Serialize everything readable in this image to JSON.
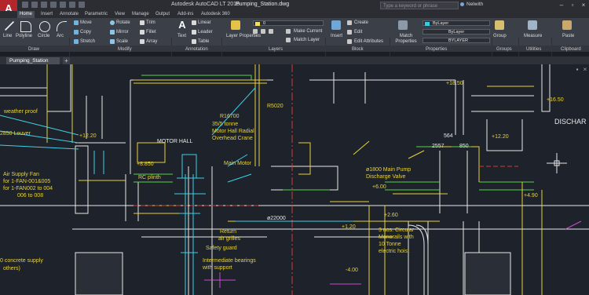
{
  "titlebar": {
    "logo": "A",
    "app_title": "Autodesk AutoCAD LT 2015",
    "doc_title": "Pumping_Station.dwg",
    "search_placeholder": "Type a keyword or phrase",
    "user": "Nelwith"
  },
  "ribbon_tabs": [
    "Home",
    "Insert",
    "Annotate",
    "Parametric",
    "View",
    "Manage",
    "Output",
    "Add-ins",
    "Autodesk 360"
  ],
  "draw_panel": {
    "label": "Draw",
    "tools": [
      "Line",
      "Polyline",
      "Circle",
      "Arc"
    ]
  },
  "modify_panel": {
    "label": "Modify",
    "tools": [
      "Move",
      "Rotate",
      "Trim",
      "Copy",
      "Mirror",
      "Fillet",
      "Stretch",
      "Scale",
      "Array"
    ]
  },
  "annotation_panel": {
    "label": "Annotation",
    "tools": [
      "Text",
      "Linear",
      "Leader",
      "Table"
    ]
  },
  "layers_panel": {
    "label": "Layers",
    "tools": [
      "Layer Properties",
      "Make Current",
      "Match Layer"
    ],
    "current_layer": "0"
  },
  "block_panel": {
    "label": "Block",
    "tools": [
      "Insert",
      "Create",
      "Edit",
      "Edit Attributes"
    ]
  },
  "properties_panel": {
    "label": "Properties",
    "match_label": "Match Properties",
    "color": "ByLayer",
    "linetype": "ByLayer",
    "lineweight": "BYLAYER"
  },
  "groups_panel": {
    "label": "Groups",
    "tool": "Group"
  },
  "utilities_panel": {
    "label": "Utilities",
    "tool": "Measure"
  },
  "clipboard_panel": {
    "label": "Clipboard",
    "tool": "Paste"
  },
  "document_tab": "Pumping_Station",
  "drawing_annotations": {
    "level_1850": "+18.50",
    "level_1650": "+16.50",
    "level_1220_left": "+12.20",
    "level_1220_right": "+12.20",
    "level_8850": "+8.850",
    "level_600": "+6.00",
    "level_490": "+4.90",
    "level_260": "+2.60",
    "level_120": "+1.20",
    "level_m400": "-4.00",
    "dim_r16700": "R16700",
    "dim_r5020": "R5020",
    "dim_22000": "ø22000",
    "dim_564": "564",
    "dim_2557": "2557",
    "dim_850": "850",
    "crane_note_1": "35/5 tonne",
    "crane_note_2": "Motor Hall Radial",
    "crane_note_3": "Overhead Crane",
    "motor_hall": "MOTOR HALL",
    "main_motor": "Main Motor",
    "rc_plinth": "RC plinth",
    "weather_proof": "weather proof",
    "louver": "2850 Louver",
    "air_supply_1": "Air Supply Fan",
    "air_supply_2": "for 1-FAN-001&005",
    "air_supply_3": "for 1-FAN002 to 004",
    "air_supply_4": "006 to 008",
    "return_grilles_1": "Return",
    "return_grilles_2": "air grilles",
    "safety_guard": "Safety guard",
    "bearings_1": "Intermediate bearings",
    "bearings_2": "with support",
    "concrete_1": "0 concrete supply",
    "concrete_2": "others)",
    "pump_valve_1": "ø1800 Main Pump",
    "pump_valve_2": "Discharge Valve",
    "monorails_1": "3 nos. Circular",
    "monorails_2": "Monorails with",
    "monorails_3": "10 Tonne",
    "monorails_4": "electric hoist",
    "discharge": "DISCHAR"
  },
  "colors": {
    "background": "#1e222a",
    "ribbon": "#3b3f47",
    "yellow": "#e6d33a",
    "cyan": "#3fd0e8",
    "white": "#e8e8e8",
    "green": "#56d34a",
    "red": "#d43a3a",
    "magenta": "#c84ad2"
  }
}
